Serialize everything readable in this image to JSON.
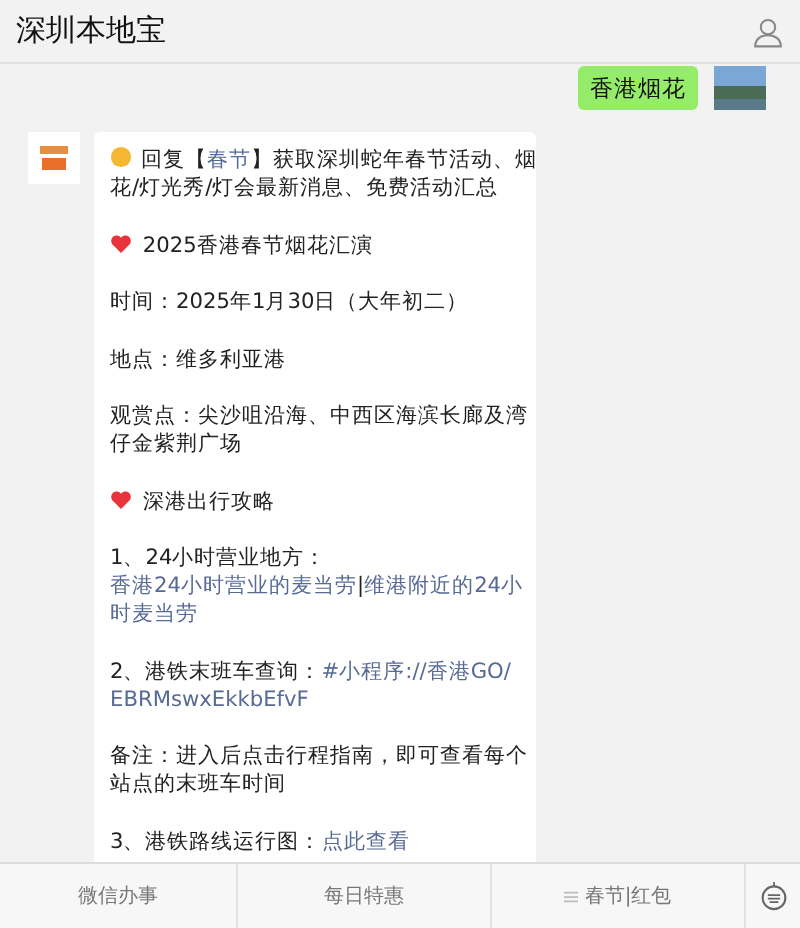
{
  "header": {
    "title": "深圳本地宝"
  },
  "outgoing": {
    "text": "香港烟花"
  },
  "incoming": {
    "paragraphs": [
      {
        "kind": "sun",
        "lines": [
          [
            {
              "text": "回复【",
              "link": false
            },
            {
              "text": "春节",
              "link": true
            },
            {
              "text": "】获取深圳蛇年春节活动、烟",
              "link": false
            }
          ],
          [
            {
              "text": "花/灯光秀/灯会最新消息、免费活动汇总",
              "link": false
            }
          ]
        ]
      },
      {
        "kind": "heart",
        "lines": [
          [
            {
              "text": "2025香港春节烟花汇演",
              "link": false
            }
          ]
        ]
      },
      {
        "kind": "plain",
        "lines": [
          [
            {
              "text": "时间：2025年1月30日（大年初二）",
              "link": false
            }
          ]
        ]
      },
      {
        "kind": "plain",
        "lines": [
          [
            {
              "text": "地点：维多利亚港",
              "link": false
            }
          ]
        ]
      },
      {
        "kind": "plain",
        "lines": [
          [
            {
              "text": "观赏点：尖沙咀沿海、中西区海滨长廊及湾",
              "link": false
            }
          ],
          [
            {
              "text": "仔金紫荆广场",
              "link": false
            }
          ]
        ]
      },
      {
        "kind": "heart",
        "lines": [
          [
            {
              "text": "深港出行攻略",
              "link": false
            }
          ]
        ]
      },
      {
        "kind": "plain",
        "lines": [
          [
            {
              "text": "1、24小时营业地方：",
              "link": false
            }
          ],
          [
            {
              "text": "香港24小时营业的麦当劳",
              "link": true
            },
            {
              "text": "|",
              "link": false
            },
            {
              "text": "维港附近的24小",
              "link": true
            }
          ],
          [
            {
              "text": "时麦当劳",
              "link": true
            }
          ]
        ]
      },
      {
        "kind": "plain",
        "lines": [
          [
            {
              "text": "2、港铁末班车查询：",
              "link": false
            },
            {
              "text": "#小程序://香港GO/",
              "link": true
            }
          ],
          [
            {
              "text": "EBRMswxEkkbEfvF",
              "link": true
            }
          ]
        ]
      },
      {
        "kind": "plain",
        "lines": [
          [
            {
              "text": "备注：进入后点击行程指南，即可查看每个",
              "link": false
            }
          ],
          [
            {
              "text": "站点的末班车时间",
              "link": false
            }
          ]
        ]
      },
      {
        "kind": "plain",
        "lines": [
          [
            {
              "text": "3、港铁路线运行图：",
              "link": false
            },
            {
              "text": "点此查看",
              "link": true
            }
          ]
        ]
      }
    ]
  },
  "menu": [
    {
      "label": "微信办事",
      "has_icon": false
    },
    {
      "label": "每日特惠",
      "has_icon": false
    },
    {
      "label": "春节|红包",
      "has_icon": true
    }
  ]
}
